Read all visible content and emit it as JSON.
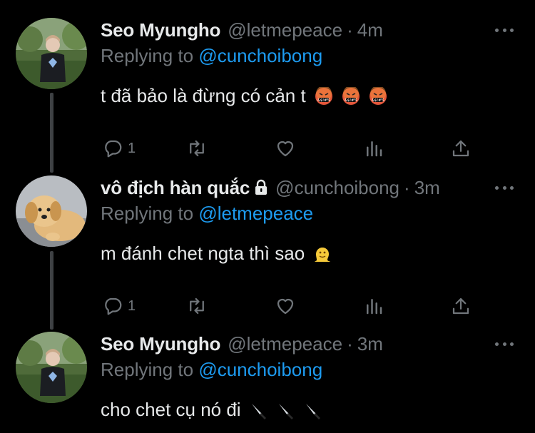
{
  "tweets": [
    {
      "name": "Seo Myungho",
      "handle": "@letmepeace",
      "time": "4m",
      "reply_prefix": "Replying to",
      "reply_to": "@cunchoibong",
      "text": "t đã bảo là đừng có cản t",
      "emojis": [
        "swearing-face-icon",
        "swearing-face-icon",
        "swearing-face-icon"
      ],
      "reply_count": "1",
      "locked": false
    },
    {
      "name": "vô địch hàn quắc",
      "handle": "@cunchoibong",
      "time": "3m",
      "reply_prefix": "Replying to",
      "reply_to": "@letmepeace",
      "text": "m đánh chet ngta thì sao",
      "emojis": [
        "melting-face-icon"
      ],
      "reply_count": "1",
      "locked": true
    },
    {
      "name": "Seo Myungho",
      "handle": "@letmepeace",
      "time": "3m",
      "reply_prefix": "Replying to",
      "reply_to": "@cunchoibong",
      "text": "cho chet cụ nó đi",
      "emojis": [
        "knife-icon",
        "knife-icon",
        "knife-icon"
      ],
      "locked": false
    }
  ],
  "separator": "·",
  "colors": {
    "background": "#000000",
    "text": "#e7e9ea",
    "secondary": "#71767b",
    "link": "#1d9bf0",
    "thread_line": "#3e4144"
  },
  "icons": [
    "reply-icon",
    "retweet-icon",
    "like-icon",
    "analytics-icon",
    "share-icon",
    "more-icon",
    "lock-icon"
  ]
}
